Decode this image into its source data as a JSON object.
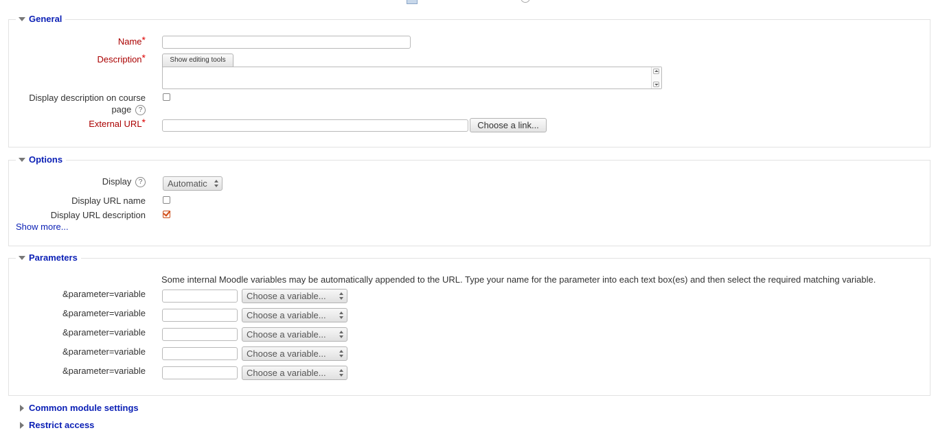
{
  "general": {
    "legend": "General",
    "name_label": "Name",
    "name_value": "",
    "description_label": "Description",
    "show_editing_tools": "Show editing tools",
    "display_desc_line1": "Display description on course",
    "display_desc_line2": "page",
    "external_url_label": "External URL",
    "external_url_value": "",
    "choose_link_button": "Choose a link..."
  },
  "options": {
    "legend": "Options",
    "display_label": "Display",
    "display_value": "Automatic",
    "display_url_name_label": "Display URL name",
    "display_url_name_checked": false,
    "display_url_description_label": "Display URL description",
    "display_url_description_checked": true,
    "show_more": "Show more..."
  },
  "parameters": {
    "legend": "Parameters",
    "info": "Some internal Moodle variables may be automatically appended to the URL. Type your name for the parameter into each text box(es) and then select the required matching variable.",
    "rows": [
      {
        "label": "&parameter=variable",
        "select": "Choose a variable..."
      },
      {
        "label": "&parameter=variable",
        "select": "Choose a variable..."
      },
      {
        "label": "&parameter=variable",
        "select": "Choose a variable..."
      },
      {
        "label": "&parameter=variable",
        "select": "Choose a variable..."
      },
      {
        "label": "&parameter=variable",
        "select": "Choose a variable..."
      }
    ]
  },
  "collapsed_sections": {
    "common_module_settings": "Common module settings",
    "restrict_access": "Restrict access"
  },
  "help_glyph": "?",
  "required_glyph": "*",
  "icons": [
    "expanded-triangle-icon",
    "collapsed-triangle-icon",
    "help-icon",
    "required-star-icon",
    "select-arrows-icon"
  ],
  "colors": {
    "link": "#0a1fb5",
    "required": "#aa0000",
    "border": "#e2e2e2"
  }
}
